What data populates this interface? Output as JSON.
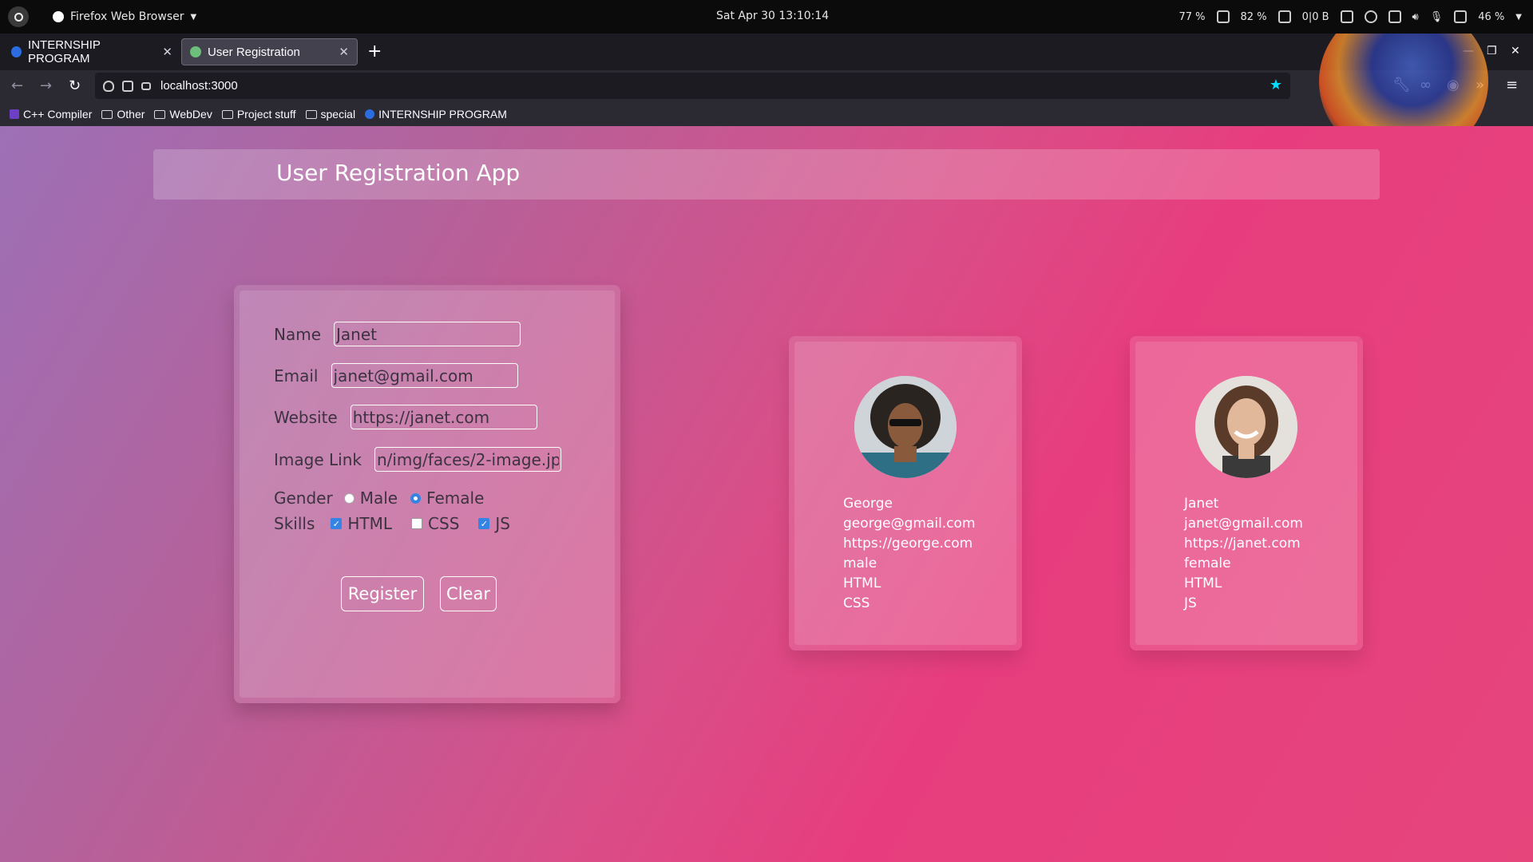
{
  "os": {
    "app_name": "Firefox Web Browser",
    "datetime": "Sat Apr 30  13:10:14",
    "cpu": "77 %",
    "mem": "82 %",
    "net": "0|0 B",
    "battery": "46 %"
  },
  "browser": {
    "tabs": [
      {
        "label": "INTERNSHIP PROGRAM"
      },
      {
        "label": "User Registration"
      }
    ],
    "url": "localhost:3000",
    "bookmarks": [
      {
        "label": "C++ Compiler",
        "icon": "compiler-icon"
      },
      {
        "label": "Other",
        "icon": "folder-icon"
      },
      {
        "label": "WebDev",
        "icon": "folder-icon"
      },
      {
        "label": "Project stuff",
        "icon": "folder-icon"
      },
      {
        "label": "special",
        "icon": "folder-icon"
      },
      {
        "label": "INTERNSHIP PROGRAM",
        "icon": "site-icon"
      }
    ]
  },
  "header": {
    "title": "User Registration App"
  },
  "form": {
    "name_label": "Name",
    "name_value": "Janet",
    "email_label": "Email",
    "email_value": "janet@gmail.com",
    "website_label": "Website",
    "website_value": "https://janet.com",
    "image_label": "Image Link",
    "image_value": "n/img/faces/2-image.jp",
    "gender_label": "Gender",
    "gender_options": [
      {
        "label": "Male",
        "checked": false
      },
      {
        "label": "Female",
        "checked": true
      }
    ],
    "skills_label": "Skills",
    "skills": [
      {
        "label": "HTML",
        "checked": true
      },
      {
        "label": "CSS",
        "checked": false
      },
      {
        "label": "JS",
        "checked": true
      }
    ],
    "register_label": "Register",
    "clear_label": "Clear"
  },
  "users": [
    {
      "name": "George",
      "email": "george@gmail.com",
      "website": "https://george.com",
      "gender": "male",
      "skill1": "HTML",
      "skill2": "CSS"
    },
    {
      "name": "Janet",
      "email": "janet@gmail.com",
      "website": "https://janet.com",
      "gender": "female",
      "skill1": "HTML",
      "skill2": "JS"
    }
  ],
  "colors": {
    "accent": "#3584e4",
    "bg_start": "#9d70b6",
    "bg_end": "#e73d7e"
  }
}
